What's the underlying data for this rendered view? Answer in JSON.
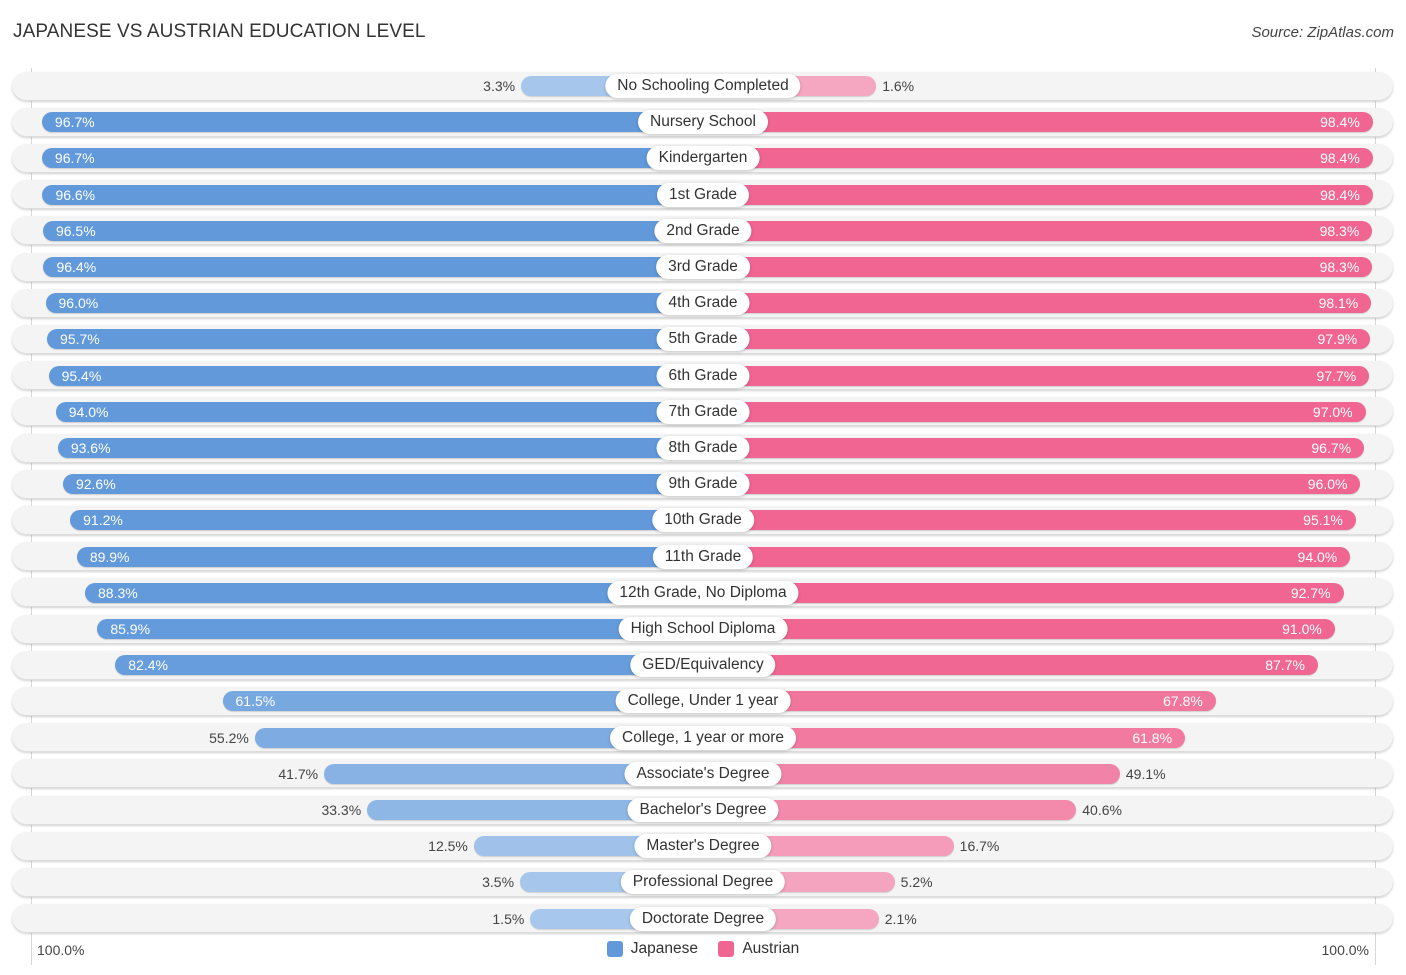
{
  "header": {
    "title": "JAPANESE VS AUSTRIAN EDUCATION LEVEL",
    "source": "Source: ZipAtlas.com"
  },
  "colors": {
    "japanese_strong": "#6199db",
    "japanese_light": "#a9c8ec",
    "austrian_strong": "#f06592",
    "austrian_light": "#f5a8c2"
  },
  "chart_data": {
    "type": "bar",
    "orientation": "horizontal-diverging",
    "title": "JAPANESE VS AUSTRIAN EDUCATION LEVEL",
    "source": "Source: ZipAtlas.com",
    "xlabel": "",
    "ylabel": "",
    "axis_left_label": "100.0%",
    "axis_right_label": "100.0%",
    "xlim": [
      0,
      100
    ],
    "legend": {
      "position": "bottom-center",
      "entries": [
        "Japanese",
        "Austrian"
      ]
    },
    "categories": [
      "No Schooling Completed",
      "Nursery School",
      "Kindergarten",
      "1st Grade",
      "2nd Grade",
      "3rd Grade",
      "4th Grade",
      "5th Grade",
      "6th Grade",
      "7th Grade",
      "8th Grade",
      "9th Grade",
      "10th Grade",
      "11th Grade",
      "12th Grade, No Diploma",
      "High School Diploma",
      "GED/Equivalency",
      "College, Under 1 year",
      "College, 1 year or more",
      "Associate's Degree",
      "Bachelor's Degree",
      "Master's Degree",
      "Professional Degree",
      "Doctorate Degree"
    ],
    "series": [
      {
        "name": "Japanese",
        "side": "left",
        "values": [
          3.3,
          96.7,
          96.7,
          96.6,
          96.5,
          96.4,
          96.0,
          95.7,
          95.4,
          94.0,
          93.6,
          92.6,
          91.2,
          89.9,
          88.3,
          85.9,
          82.4,
          61.5,
          55.2,
          41.7,
          33.3,
          12.5,
          3.5,
          1.5
        ],
        "labels": [
          "3.3%",
          "96.7%",
          "96.7%",
          "96.6%",
          "96.5%",
          "96.4%",
          "96.0%",
          "95.7%",
          "95.4%",
          "94.0%",
          "93.6%",
          "92.6%",
          "91.2%",
          "89.9%",
          "88.3%",
          "85.9%",
          "82.4%",
          "61.5%",
          "55.2%",
          "41.7%",
          "33.3%",
          "12.5%",
          "3.5%",
          "1.5%"
        ]
      },
      {
        "name": "Austrian",
        "side": "right",
        "values": [
          1.6,
          98.4,
          98.4,
          98.4,
          98.3,
          98.3,
          98.1,
          97.9,
          97.7,
          97.0,
          96.7,
          96.0,
          95.1,
          94.0,
          92.7,
          91.0,
          87.7,
          67.8,
          61.8,
          49.1,
          40.6,
          16.7,
          5.2,
          2.1
        ],
        "labels": [
          "1.6%",
          "98.4%",
          "98.4%",
          "98.4%",
          "98.3%",
          "98.3%",
          "98.1%",
          "97.9%",
          "97.7%",
          "97.0%",
          "96.7%",
          "96.0%",
          "95.1%",
          "94.0%",
          "92.7%",
          "91.0%",
          "87.7%",
          "67.8%",
          "61.8%",
          "49.1%",
          "40.6%",
          "16.7%",
          "5.2%",
          "2.1%"
        ]
      }
    ]
  }
}
